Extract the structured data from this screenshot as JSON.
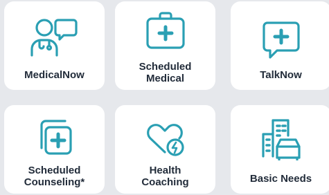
{
  "accent_color": "#2a9fb3",
  "tiles": [
    {
      "label": "MedicalNow",
      "icon": "doctor-chat-icon"
    },
    {
      "label": "Scheduled\nMedical",
      "icon": "medical-kit-icon"
    },
    {
      "label": "TalkNow",
      "icon": "chat-plus-icon"
    },
    {
      "label": "Scheduled\nCounseling*",
      "icon": "stacked-cards-plus-icon"
    },
    {
      "label": "Health\nCoaching",
      "icon": "heart-bolt-icon"
    },
    {
      "label": "Basic Needs",
      "icon": "building-car-icon"
    }
  ]
}
